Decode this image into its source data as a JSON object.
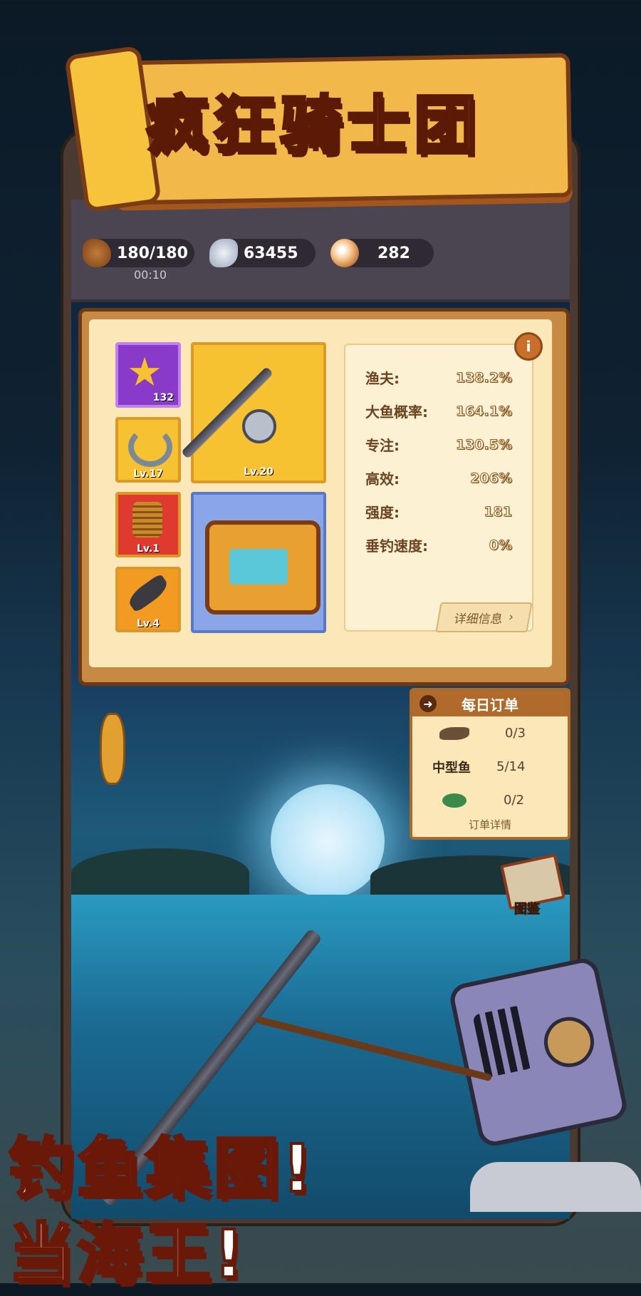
{
  "title": "疯狂骑士团",
  "resources": {
    "bread": {
      "value": "180/180",
      "timer": "00:10",
      "icon": "bread-icon"
    },
    "fish": {
      "value": "63455",
      "icon": "fish-icon"
    },
    "pearl": {
      "value": "282",
      "icon": "pearl-icon"
    }
  },
  "equipment": {
    "star": {
      "count": "132",
      "icon": "star-icon"
    },
    "hook": {
      "level": "Lv.17",
      "icon": "hook-icon"
    },
    "line": {
      "level": "Lv.1",
      "icon": "fishing-line-icon"
    },
    "bait": {
      "level": "Lv.4",
      "icon": "bait-fish-icon"
    },
    "rod": {
      "level": "Lv.20",
      "icon": "fishing-rod-icon"
    },
    "chest": {
      "icon": "treasure-chest-icon"
    }
  },
  "stats": [
    {
      "label": "渔夫:",
      "value": "138.2%"
    },
    {
      "label": "大鱼概率:",
      "value": "164.1%"
    },
    {
      "label": "专注:",
      "value": "130.5%"
    },
    {
      "label": "高效:",
      "value": "206%"
    },
    {
      "label": "强度:",
      "value": "181"
    },
    {
      "label": "垂钓速度:",
      "value": "0%"
    }
  ],
  "detail_button": "详细信息",
  "daily_order": {
    "title": "每日订单",
    "rows": [
      {
        "label": "",
        "value": "0/3",
        "icon": "fish-silhouette-icon"
      },
      {
        "label": "中型鱼",
        "value": "5/14",
        "icon": ""
      },
      {
        "label": "",
        "value": "0/2",
        "icon": "turtle-icon"
      }
    ],
    "footer": "订单详情"
  },
  "book_label": "图鉴",
  "slogan": {
    "line1": "钓鱼集图!",
    "line2": "当海王!"
  },
  "colors": {
    "title_red": "#e23a1e",
    "banner_gold": "#f3b84a",
    "panel_brown": "#c78a44"
  }
}
